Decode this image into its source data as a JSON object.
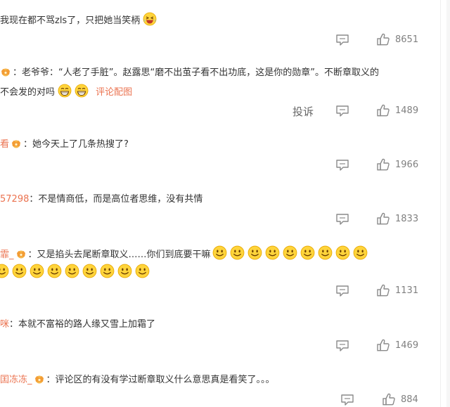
{
  "comments": [
    {
      "username": "",
      "text": "我现在都不骂zls了，只把她当笑柄",
      "comment_icon": "comment-icon",
      "like_icon": "thumb-up-icon",
      "likes": "8651"
    },
    {
      "username": "",
      "separator": "：",
      "text_line1": "老爷爷：“人老了手脏”。赵露思“磨不出茧子看不出功底，这是你的勋章”。不断章取义的",
      "text_line2": "不会发的对吗",
      "pic_link": "评论配图",
      "report": "投诉",
      "likes": "1489"
    },
    {
      "username": "看",
      "separator": "：",
      "text": "她今天上了几条热搜了?",
      "likes": "1966"
    },
    {
      "username": "57298",
      "separator": "：",
      "text": "不是情商低，而是高位者思维，没有共情",
      "likes": "1833"
    },
    {
      "username": "霏_",
      "separator": "：",
      "text": "又是掐头去尾断章取义……你们到底要干嘛",
      "likes": "1131"
    },
    {
      "username": "咪",
      "separator": "：",
      "text": "本就不富裕的路人缘又雪上加霜了",
      "likes": "1469"
    },
    {
      "username": "囯冻冻_",
      "separator": "：",
      "text": "评论区的有没有学过断章取义什么意思真是看笑了。。。",
      "likes": "884"
    }
  ],
  "colors": {
    "username": "#eb7350",
    "text": "#333333",
    "meta": "#808080",
    "emoji_yellow": "#ffd43b"
  },
  "icons": [
    "comment-icon",
    "thumb-up-icon",
    "crown-badge-icon",
    "smile-emoji-icon",
    "grin-emoji-icon",
    "laugh-cry-emoji-icon"
  ]
}
